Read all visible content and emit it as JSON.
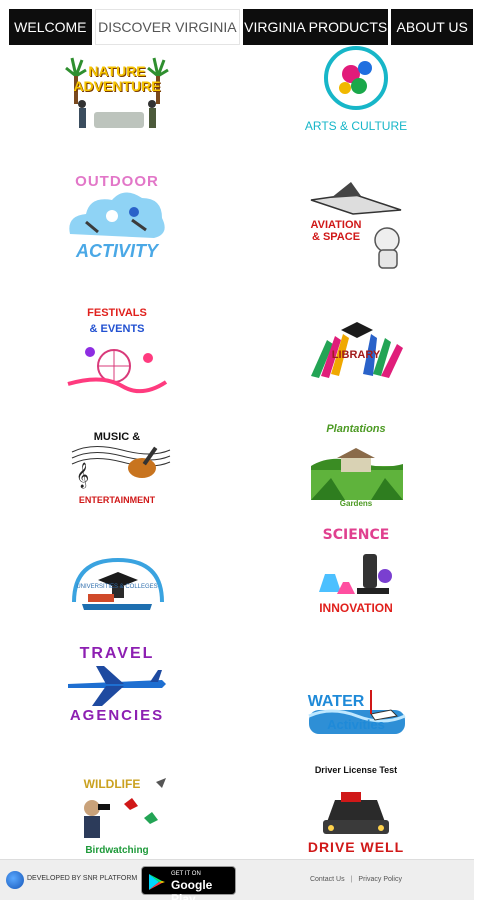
{
  "tabs": [
    {
      "label": "WELCOME",
      "active": false
    },
    {
      "label": "DISCOVER VIRGINIA",
      "active": true
    },
    {
      "label": "VIRGINIA PRODUCTS",
      "active": false
    },
    {
      "label": "ABOUT US",
      "active": false
    }
  ],
  "categories": [
    {
      "id": "nature",
      "lines": [
        "NATURE",
        "ADVENTURE"
      ]
    },
    {
      "id": "arts",
      "lines": [
        "ARTS & CULTURE"
      ]
    },
    {
      "id": "outdoor",
      "lines": [
        "OUTDOOR",
        "ACTIVITY"
      ]
    },
    {
      "id": "aviation",
      "lines": [
        "AVIATION",
        "& SPACE"
      ]
    },
    {
      "id": "festivals",
      "lines": [
        "FESTIVALS",
        "& EVENTS"
      ]
    },
    {
      "id": "library",
      "lines": [
        "LIBRARY"
      ]
    },
    {
      "id": "music",
      "lines": [
        "MUSIC &",
        "ENTERTAINMENT"
      ]
    },
    {
      "id": "plantations",
      "lines": [
        "Plantations",
        "Gardens"
      ]
    },
    {
      "id": "universities",
      "lines": [
        "UNIVERSITIES & COLLEGES"
      ]
    },
    {
      "id": "science",
      "lines": [
        "SCIENCE",
        "INNOVATION"
      ]
    },
    {
      "id": "travel",
      "lines": [
        "TRAVEL",
        "AGENCIES"
      ]
    },
    {
      "id": "water",
      "lines": [
        "WATER",
        "Activities"
      ]
    },
    {
      "id": "wildlife",
      "lines": [
        "WILDLIFE",
        "Birdwatching"
      ]
    },
    {
      "id": "driving",
      "lines": [
        "Driver License Test",
        "DRIVE WELL"
      ]
    }
  ],
  "footer": {
    "developer": "DEVELOPED BY SNR PLATFORM",
    "store_small": "GET IT ON",
    "store_big": "Google Play",
    "contact": "Contact Us",
    "separator": "|",
    "privacy": "Privacy Policy"
  },
  "colors": {
    "tab_bg": "#0d0d0d",
    "tab_active_bg": "#ffffff",
    "footer_bg": "#eeeeee"
  }
}
